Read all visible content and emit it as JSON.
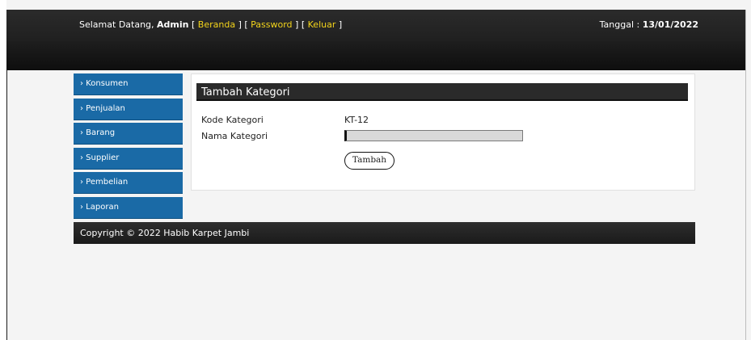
{
  "header": {
    "welcome_prefix": "Selamat Datang,",
    "user": "Admin",
    "links": [
      "Beranda",
      "Password",
      "Keluar"
    ],
    "date_label": "Tanggal :",
    "date_value": "13/01/2022"
  },
  "sidebar": {
    "items": [
      {
        "label": "› Konsumen"
      },
      {
        "label": "› Penjualan"
      },
      {
        "label": "› Barang"
      },
      {
        "label": "› Supplier"
      },
      {
        "label": "› Pembelian"
      },
      {
        "label": "› Laporan"
      }
    ]
  },
  "form": {
    "title": "Tambah Kategori",
    "kode_label": "Kode Kategori",
    "kode_value": "KT-12",
    "nama_label": "Nama Kategori",
    "nama_value": "",
    "submit_label": "Tambah"
  },
  "footer": {
    "text": "Copyright © 2022 Habib Karpet Jambi"
  }
}
